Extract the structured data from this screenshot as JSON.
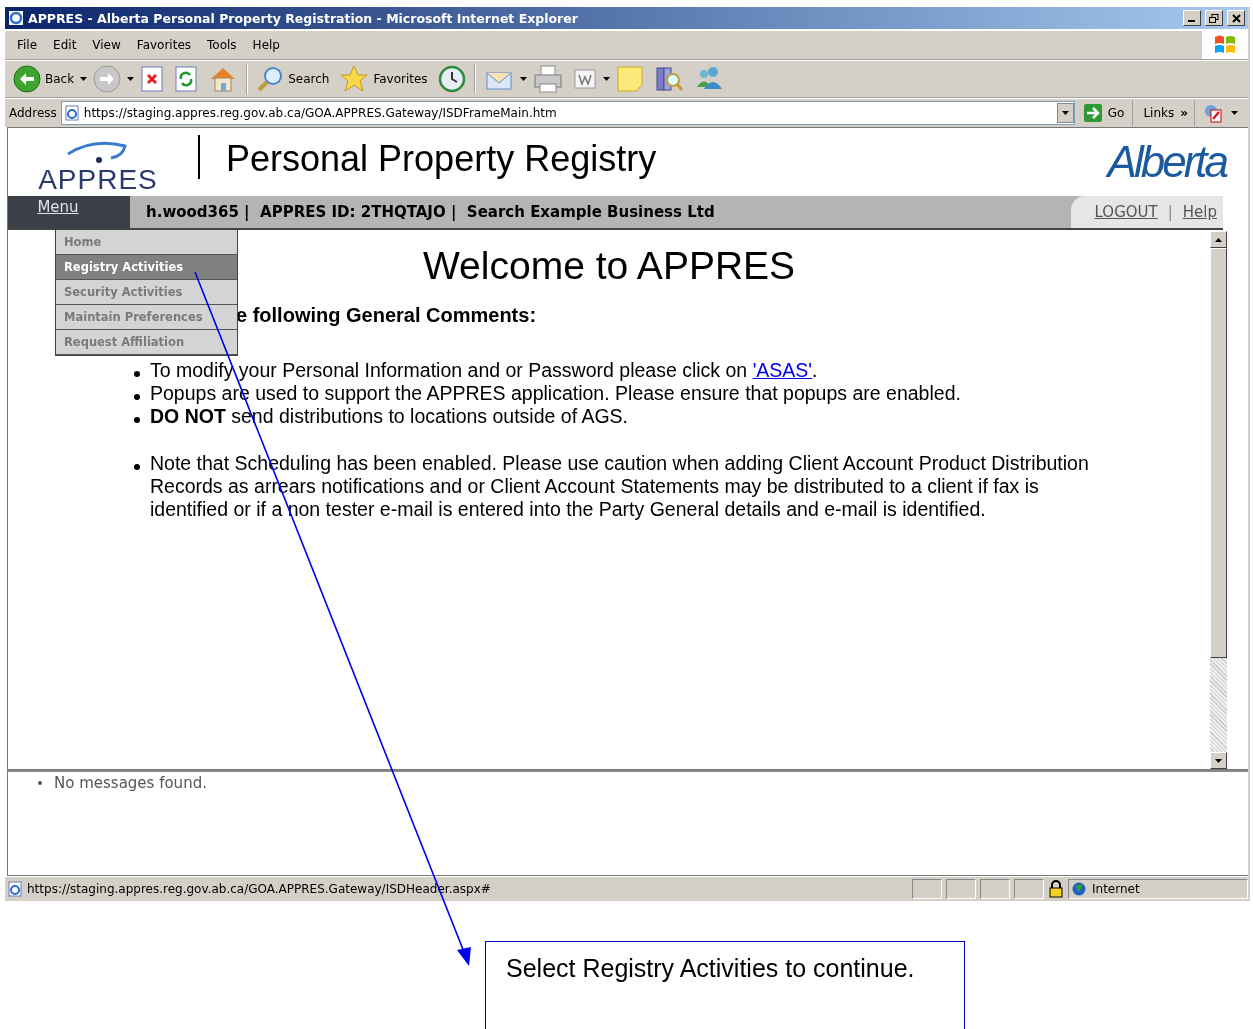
{
  "window": {
    "title": "APPRES - Alberta Personal Property Registration - Microsoft Internet Explorer"
  },
  "menu_bar": [
    "File",
    "Edit",
    "View",
    "Favorites",
    "Tools",
    "Help"
  ],
  "toolbar": [
    {
      "kind": "back",
      "label": "Back",
      "has_menu": true
    },
    {
      "kind": "forward",
      "has_menu": true
    },
    {
      "kind": "stop",
      "has_menu": false
    },
    {
      "kind": "refresh",
      "has_menu": false
    },
    {
      "kind": "home",
      "has_menu": false
    },
    {
      "kind": "search",
      "label": "Search",
      "has_menu": false
    },
    {
      "kind": "favorites",
      "label": "Favorites",
      "has_menu": false
    },
    {
      "kind": "history",
      "has_menu": false
    },
    {
      "kind": "mail",
      "has_menu": true
    },
    {
      "kind": "print",
      "has_menu": false
    },
    {
      "kind": "edit",
      "has_menu": true
    },
    {
      "kind": "note",
      "has_menu": false
    },
    {
      "kind": "research",
      "has_menu": false
    },
    {
      "kind": "messenger",
      "has_menu": false
    }
  ],
  "address_bar": {
    "label": "Address",
    "url": "https://staging.appres.reg.gov.ab.ca/GOA.APPRES.Gateway/ISDFrameMain.htm",
    "go": "Go",
    "links": "Links",
    "more": "»"
  },
  "page": {
    "logo": "APPRES",
    "title": "Personal Property Registry",
    "brand": "Alberta",
    "nav": {
      "menu": "Menu",
      "info": "h.wood365 |  APPRES ID: 2THQTAJO |  Search Example Business Ltd",
      "logout": "LOGOUT",
      "separator": "|",
      "help": "Help"
    },
    "menu_items": [
      {
        "label": "Home",
        "selected": false
      },
      {
        "label": "Registry Activities",
        "selected": true
      },
      {
        "label": "Security Activities",
        "selected": false
      },
      {
        "label": "Maintain Preferences",
        "selected": false
      },
      {
        "label": "Request Affiliation",
        "selected": false
      }
    ],
    "welcome": "Welcome to APPRES",
    "comments_heading": "e following General Comments:",
    "comment_groups": [
      [
        {
          "text": "To modify your Personal Information and or Password please click on ",
          "link": "'ASAS'",
          "after": "."
        },
        {
          "text": "Popups are used to support the APPRES application.  Please ensure that popups are enabled."
        },
        {
          "text": "**DO NOT** send distributions to locations outside of AGS."
        }
      ],
      [
        {
          "text": "Note that Scheduling has been enabled. Please use caution when adding Client Account Product Distribution Records as arrears notifications and or Client Account Statements may be distributed to a client if fax is identified or if a non tester e-mail is entered into the Party General details and e-mail is identified."
        }
      ]
    ]
  },
  "messages": [
    "No messages found."
  ],
  "status_bar": {
    "url": "https://staging.appres.reg.gov.ab.ca/GOA.APPRES.Gateway/ISDHeader.aspx#",
    "zone": "Internet"
  },
  "callout": {
    "text": "Select Registry Activities to continue."
  }
}
